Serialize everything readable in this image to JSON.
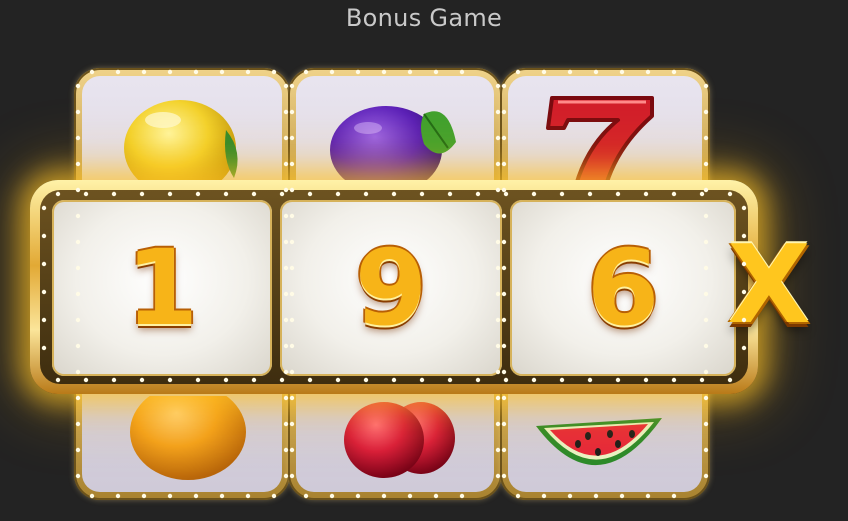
{
  "title": "Bonus Game",
  "reels": [
    {
      "top_symbol": "lemon-icon",
      "bottom_symbol": "orange-icon"
    },
    {
      "top_symbol": "plum-icon",
      "bottom_symbol": "cherry-icon"
    },
    {
      "top_symbol": "seven-icon",
      "bottom_symbol": "watermelon-icon"
    }
  ],
  "multiplier": {
    "digits": [
      "1",
      "9",
      "6"
    ],
    "suffix": "X"
  },
  "colors": {
    "background": "#232323",
    "gold": "#e2a935",
    "digit": "#f7b418"
  }
}
